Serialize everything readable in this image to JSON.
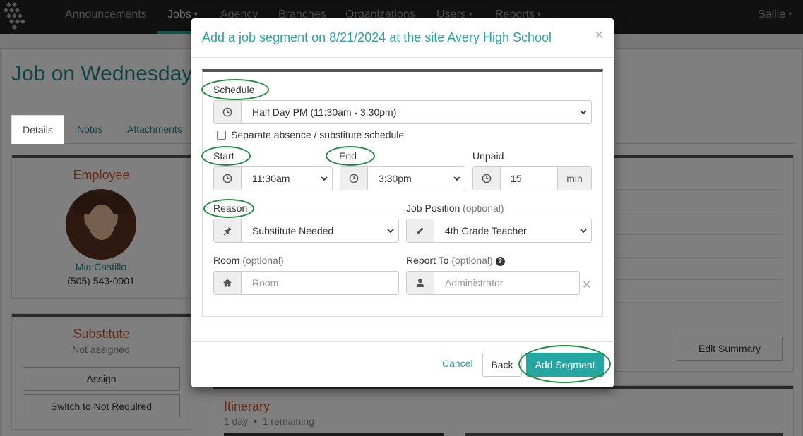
{
  "nav": {
    "items": [
      "Announcements",
      "Jobs",
      "Agency",
      "Branches",
      "Organizations",
      "Users",
      "Reports"
    ],
    "user": "Sallie"
  },
  "page": {
    "title": "Job on Wednesday,",
    "tabs": [
      "Details",
      "Notes",
      "Attachments"
    ],
    "employee": {
      "heading": "Employee",
      "name": "Mia Castillo",
      "phone": "(505) 543-0901"
    },
    "substitute": {
      "heading": "Substitute",
      "status": "Not assigned",
      "assign_label": "Assign",
      "not_required_label": "Switch to Not Required"
    },
    "edit_summary_label": "Edit Summary",
    "itinerary": {
      "heading": "Itinerary",
      "days": "1 day",
      "remaining": "1 remaining"
    }
  },
  "modal": {
    "title": "Add a job segment on 8/21/2024 at the site Avery High School",
    "close": "×",
    "schedule": {
      "label": "Schedule",
      "value": "Half Day PM (11:30am - 3:30pm)"
    },
    "separate_label": "Separate absence / substitute schedule",
    "start": {
      "label": "Start",
      "value": "11:30am"
    },
    "end": {
      "label": "End",
      "value": "3:30pm"
    },
    "unpaid": {
      "label": "Unpaid",
      "value": "15",
      "unit": "min"
    },
    "reason": {
      "label": "Reason",
      "value": "Substitute Needed"
    },
    "job_position": {
      "label": "Job Position",
      "optional": "(optional)",
      "value": "4th Grade Teacher"
    },
    "room": {
      "label": "Room",
      "optional": "(optional)",
      "placeholder": "Room"
    },
    "report_to": {
      "label": "Report To",
      "optional": "(optional)",
      "placeholder": "Administrator"
    },
    "buttons": {
      "cancel": "Cancel",
      "back": "Back",
      "add": "Add Segment"
    }
  },
  "colors": {
    "accent": "#26a6a0",
    "section_heading": "#c8552b",
    "highlight_ring": "#1e8f3e",
    "navbar": "#222222"
  }
}
